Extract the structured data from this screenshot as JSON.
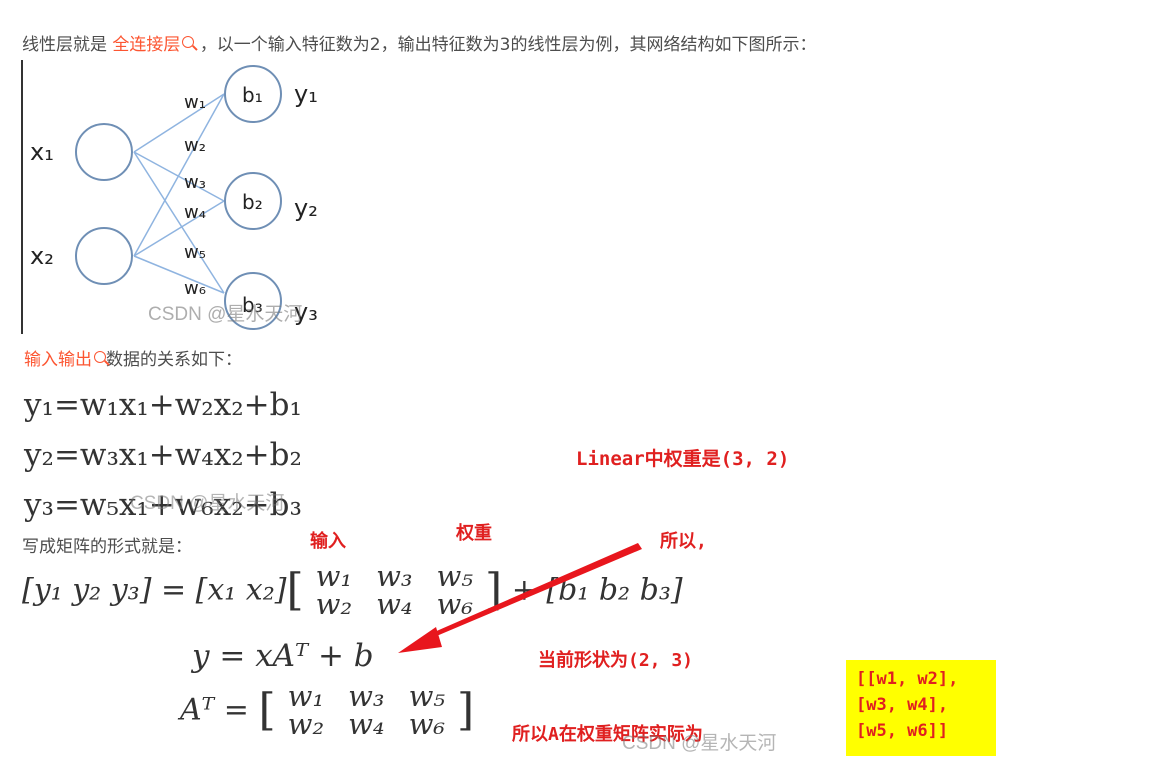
{
  "intro": {
    "before": "线性层就是",
    "link": "全连接层",
    "after": "，以一个输入特征数为2，输出特征数为3的线性层为例，其网络结构如下图所示："
  },
  "figure": {
    "inputs": [
      "x₁",
      "x₂"
    ],
    "outputs": [
      "y₁",
      "y₂",
      "y₃"
    ],
    "biases": [
      "b₁",
      "b₂",
      "b₃"
    ],
    "weights": [
      "w₁",
      "w₂",
      "w₃",
      "w₄",
      "w₅",
      "w₆"
    ],
    "watermark": "CSDN @星水天河"
  },
  "relation": {
    "link": "输入输出",
    "after": "数据的关系如下："
  },
  "equations": [
    "y₁=w₁x₁+w₂x₂+b₁",
    "y₂=w₃x₁+w₄x₂+b₂",
    "y₃=w₅x₁+w₆x₂+b₃"
  ],
  "eq_watermark": "CSDN @星水天河",
  "matrix_intro": "写成矩阵的形式就是：",
  "matrix_eq": {
    "lhs": "[y₁   y₂   y₃] = [x₁   x₂]",
    "w_matrix": [
      [
        "w₁",
        "w₃",
        "w₅"
      ],
      [
        "w₂",
        "w₄",
        "w₆"
      ]
    ],
    "plus_b": "+ [b₁   b₂   b₃]",
    "compact": "y = xAᵀ + b",
    "at_lhs": "Aᵀ = "
  },
  "annotations": {
    "linear_weight": "Linear中权重是(3, 2)",
    "input": "输入",
    "weight": "权重",
    "so": "所以,",
    "current_shape": "当前形状为(2, 3)",
    "so_A": "所以A在权重矩阵实际为"
  },
  "yellow_box": [
    "[[w1, w2],",
    "[w3, w4],",
    "[w5, w6]]"
  ],
  "bottom_watermark": "CSDN @星水天河",
  "colors": {
    "link": "#fc5531",
    "annotation": "#e02020",
    "highlight": "#ffff00",
    "node_stroke": "#6f8fb5",
    "edge": "#8fb4e0"
  }
}
